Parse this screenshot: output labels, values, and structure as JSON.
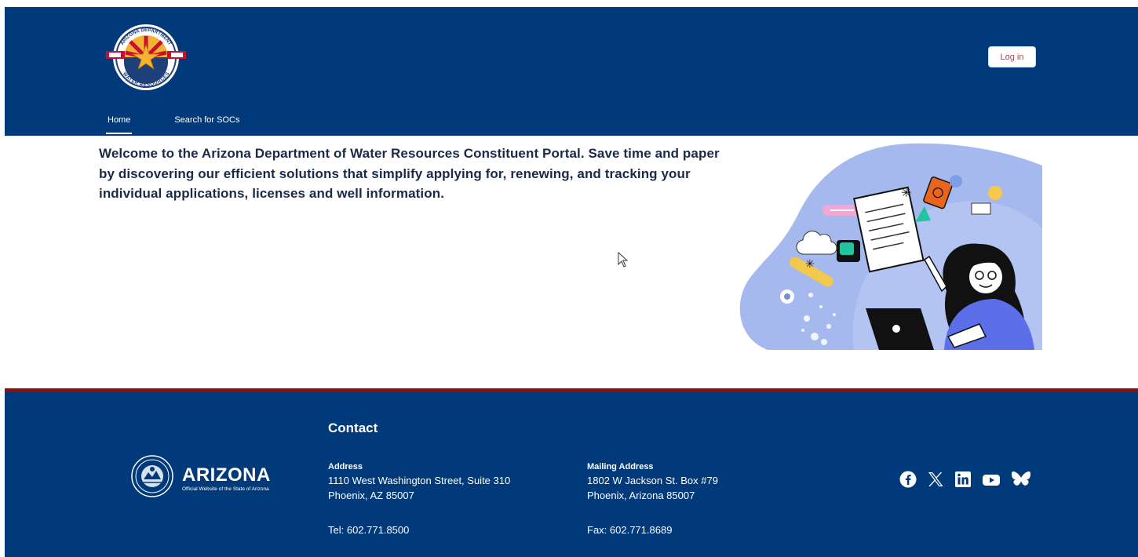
{
  "header": {
    "logo_name": "Arizona Department of Water Resources",
    "logo_text_top": "ARIZONA DEPARTMENT",
    "logo_text_bottom": "WATER RESOURCES",
    "login_label": "Log in",
    "nav": [
      {
        "label": "Home",
        "active": true
      },
      {
        "label": "Search for SOCs",
        "active": false
      }
    ]
  },
  "main": {
    "welcome_text": "Welcome to the Arizona Department of Water Resources Constituent Portal. Save time and paper by discovering our efficient solutions that simplify applying for, renewing, and tracking your individual applications, licenses and well information."
  },
  "footer": {
    "state_word": "ARIZONA",
    "state_tagline": "Official Website of the State of Arizona",
    "contact_title": "Contact",
    "address": {
      "heading": "Address",
      "line1": "1110 West Washington Street, Suite 310",
      "line2": "Phoenix, AZ 85007",
      "tel": "Tel: 602.771.8500"
    },
    "mailing": {
      "heading": "Mailing Address",
      "line1": "1802 W Jackson St. Box #79",
      "line2": "Phoenix, Arizona 85007",
      "fax": "Fax: 602.771.8689"
    },
    "social_icons": [
      "facebook-icon",
      "x-icon",
      "linkedin-icon",
      "youtube-icon",
      "bluesky-icon"
    ]
  },
  "colors": {
    "brand_navy": "#003a7a",
    "footer_accent": "#8b1014",
    "login_text": "#c23934",
    "body_text": "#1a2a47",
    "hero_blob": "#a6b9ee"
  }
}
